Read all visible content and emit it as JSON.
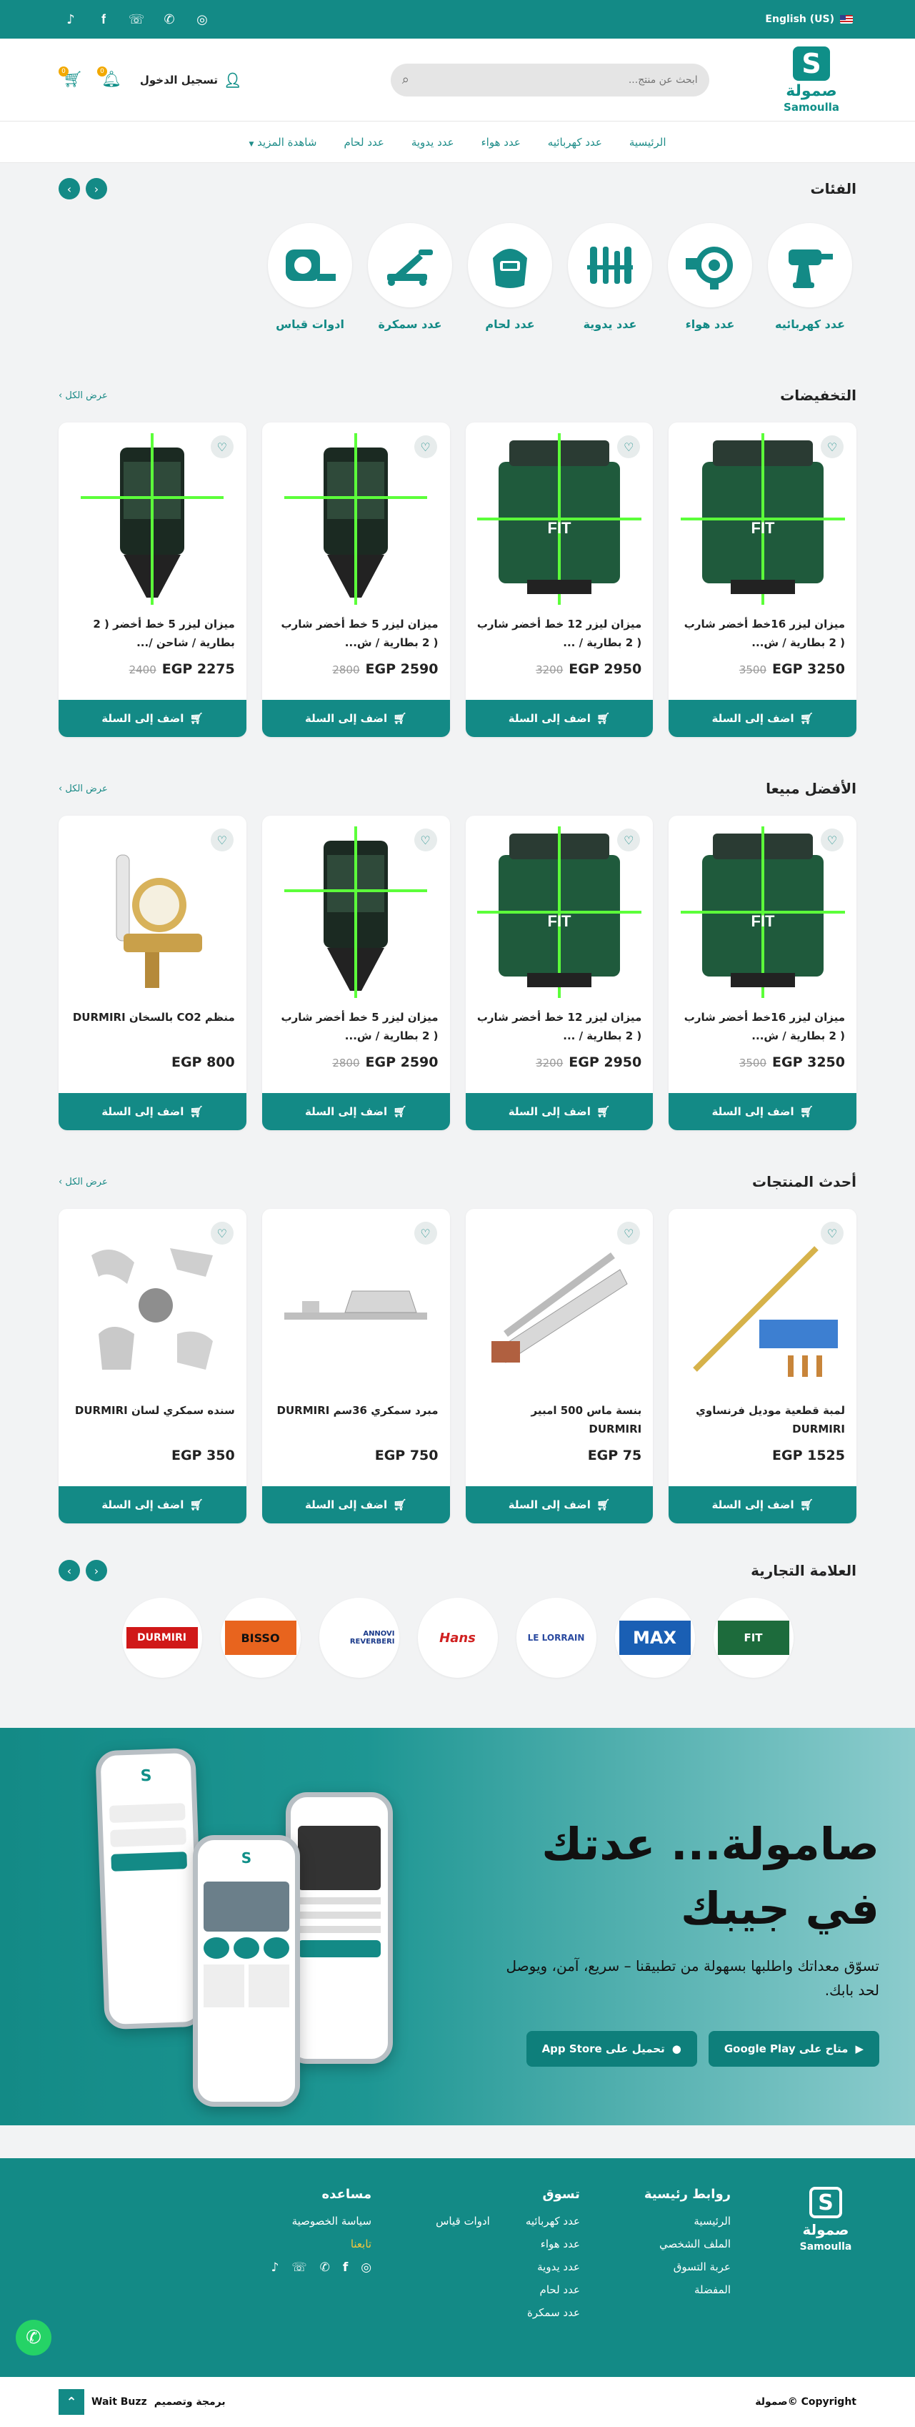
{
  "topbar": {
    "language": "English (US)",
    "icons": [
      "instagram-icon",
      "whatsapp-icon",
      "phone-icon",
      "facebook-icon",
      "tiktok-icon"
    ]
  },
  "header": {
    "logo_ar": "صمولة",
    "logo_en": "Samoulla",
    "search_placeholder": "ابحث عن منتج...",
    "login_label": "تسجيل الدخول",
    "wishlist_count": "0",
    "cart_count": "0"
  },
  "nav": [
    "الرئيسية",
    "عدد كهربائيه",
    "عدد هواء",
    "عدد يدوية",
    "عدد لحام",
    "شاهدة المزيد"
  ],
  "categories": {
    "title": "الفئات",
    "items": [
      {
        "label": "عدد كهربائيه",
        "icon": "drill-icon"
      },
      {
        "label": "عدد هواء",
        "icon": "blower-icon"
      },
      {
        "label": "عدد يدوية",
        "icon": "hand-tools-icon"
      },
      {
        "label": "عدد لحام",
        "icon": "welding-mask-icon"
      },
      {
        "label": "عدد سمكرة",
        "icon": "car-jack-icon"
      },
      {
        "label": "ادوات قياس",
        "icon": "tape-measure-icon"
      }
    ]
  },
  "view_all": "عرض الكل",
  "add_to_cart": "اضف إلى السلة",
  "discounts": {
    "title": "التخفيضات",
    "products": [
      {
        "title": "ميزان ليزر 16خط أخضر شارب ( 2 بطارية / ش...",
        "price": "EGP 3250",
        "old": "3500",
        "image": "laser-fit-16"
      },
      {
        "title": "ميزان ليزر 12 خط أخضر شارب ( 2 بطارية / ...",
        "price": "EGP 2950",
        "old": "3200",
        "image": "laser-fit-12"
      },
      {
        "title": "ميزان ليزر 5 خط أخضر شارب ( 2 بطارية / ش...",
        "price": "EGP 2590",
        "old": "2800",
        "image": "laser-5"
      },
      {
        "title": "ميزان ليزر 5 خط أخضر ( 2 بطارية / شاحن /...",
        "price": "EGP 2275",
        "old": "2400",
        "image": "laser-5b"
      }
    ]
  },
  "bestsellers": {
    "title": "الأفضل مبيعا",
    "products": [
      {
        "title": "ميزان ليزر 16خط أخضر شارب ( 2 بطارية / ش...",
        "price": "EGP 3250",
        "old": "3500",
        "image": "laser-fit-16"
      },
      {
        "title": "ميزان ليزر 12 خط أخضر شارب ( 2 بطارية / ...",
        "price": "EGP 2950",
        "old": "3200",
        "image": "laser-fit-12"
      },
      {
        "title": "ميزان ليزر 5 خط أخضر شارب ( 2 بطارية / ش...",
        "price": "EGP 2590",
        "old": "2800",
        "image": "laser-5"
      },
      {
        "title": "منظم CO2 بالسخان DURMIRI",
        "price": "EGP 800",
        "old": "",
        "image": "regulator"
      }
    ]
  },
  "newest": {
    "title": "أحدث المنتجات",
    "products": [
      {
        "title": "لمبة قطعية موديل فرنساوي DURMIRI",
        "price": "EGP 1525",
        "old": "",
        "image": "torch"
      },
      {
        "title": "بنسة ماس 500 امبير DURMIRI",
        "price": "EGP 75",
        "old": "",
        "image": "clamp"
      },
      {
        "title": "مبرد سمكري 36سم DURMIRI",
        "price": "EGP 750",
        "old": "",
        "image": "file"
      },
      {
        "title": "سنده سمكري لسان DURMIRI",
        "price": "EGP 350",
        "old": "",
        "image": "dolly"
      }
    ]
  },
  "brands": {
    "title": "العلامة التجارية",
    "items": [
      {
        "name": "FIT",
        "bg": "#1d6b3c",
        "fg": "#ffffff"
      },
      {
        "name": "MAX",
        "bg": "#1a5fb4",
        "fg": "#ffffff"
      },
      {
        "name": "LE LORRAIN",
        "bg": "#ffffff",
        "fg": "#2a4aa0"
      },
      {
        "name": "Hans",
        "bg": "#ffffff",
        "fg": "#d02020"
      },
      {
        "name": "ANNOVI REVERBERI",
        "bg": "#ffffff",
        "fg": "#1a3a8a"
      },
      {
        "name": "BISSO",
        "bg": "#e8641e",
        "fg": "#111111"
      },
      {
        "name": "DURMIRI",
        "bg": "#ffffff",
        "fg": "#d01818"
      }
    ]
  },
  "promo": {
    "headline": "صامولة... عدتك في جيبك",
    "text": "تسوّق معداتك واطلبها بسهولة من تطبيقنا – سريع، آمن، ويوصل لحد بابك.",
    "google_play": "متاح على Google Play",
    "app_store": "تحميل على App Store"
  },
  "footer": {
    "logo_ar": "صمولة",
    "logo_en": "Samoulla",
    "col1": {
      "title": "روابط رئيسية",
      "links": [
        "الرئيسية",
        "الملف الشخصي",
        "عربة التسوق",
        "المفضلة"
      ]
    },
    "col2": {
      "title": "تسوق",
      "links": [
        "عدد كهربائيه",
        "ادوات قياس",
        "عدد هواء",
        "عدد يدوية",
        "عدد لحام",
        "عدد سمكرة"
      ]
    },
    "col3": {
      "title": "مساعده",
      "links": [
        "سياسة الخصوصية"
      ],
      "highlight": "تابعنا"
    },
    "copyright": "Copyright ©صمولة",
    "credit_text": "برمجة وتصميم",
    "credit_brand": "Wait Buzz"
  },
  "colors": {
    "primary": "#138a86",
    "accent": "#f2a900"
  }
}
